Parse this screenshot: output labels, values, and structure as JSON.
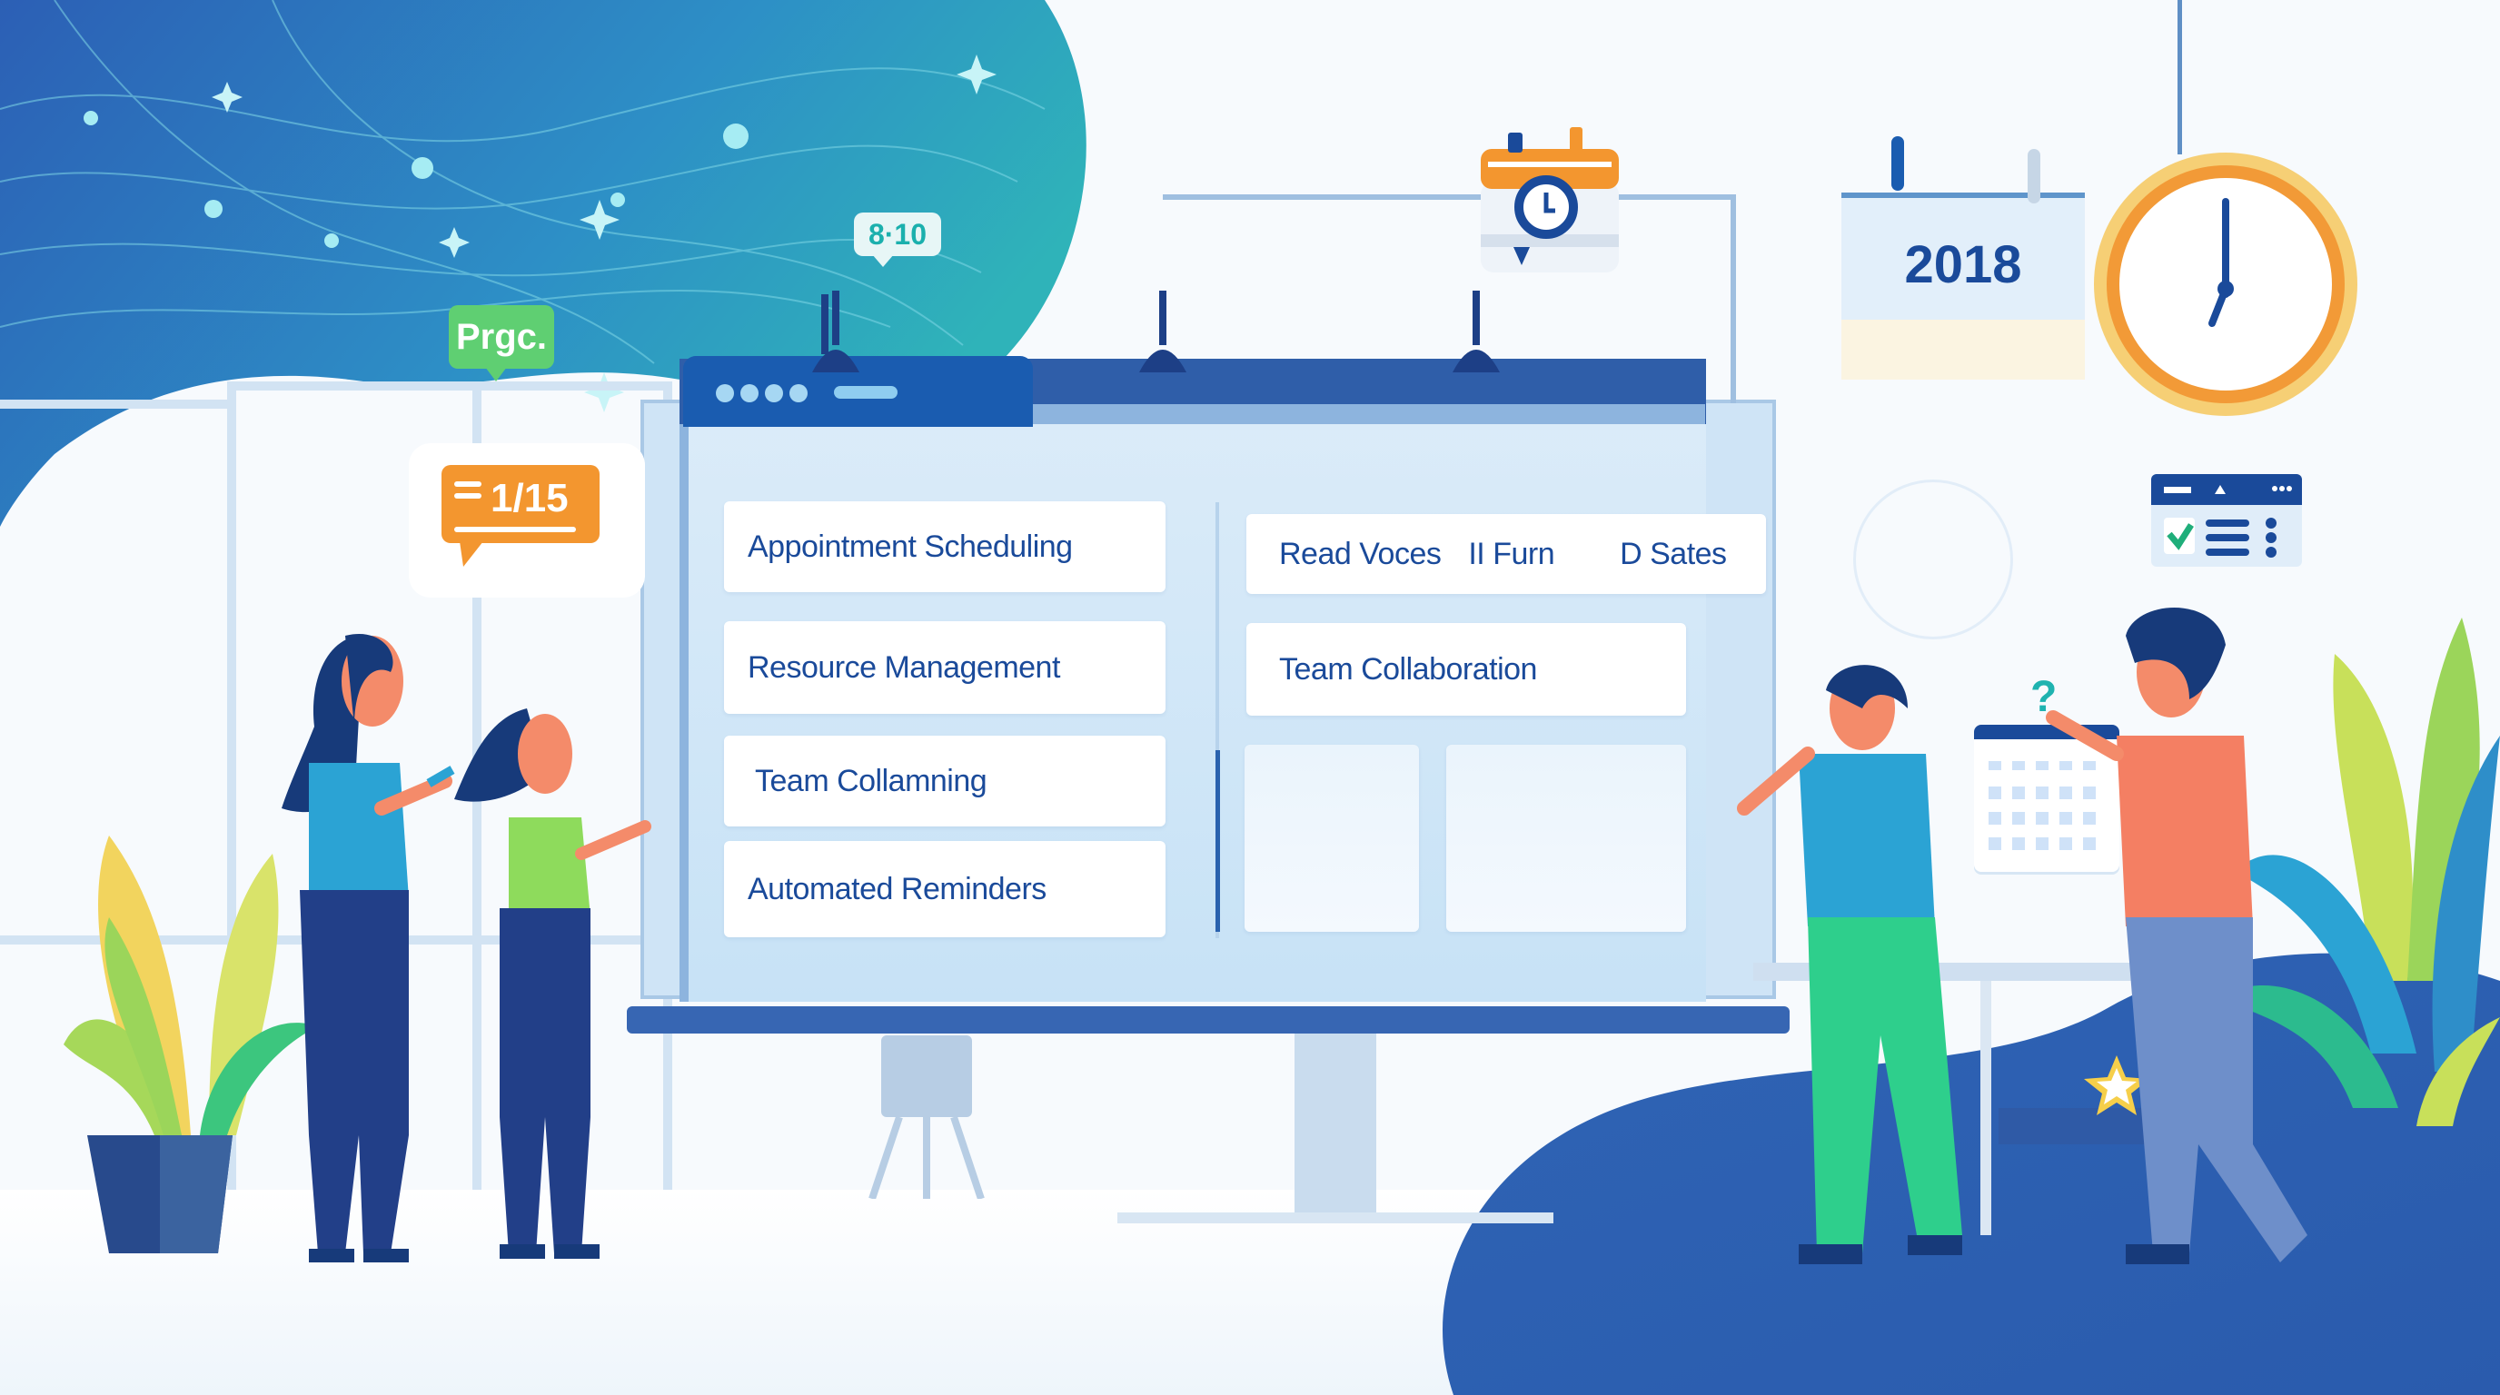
{
  "scene": {
    "description": "Flat illustration of a team using a scheduling app dashboard"
  },
  "panel": {
    "left_column": [
      {
        "label": "Appointment Scheduling"
      },
      {
        "label": "Resource Management"
      },
      {
        "label": "Team Collamning"
      },
      {
        "label": "Automated Reminders"
      }
    ],
    "right_column": {
      "header_items": [
        "Read Voces",
        "II Furn",
        "D Sates"
      ],
      "cards": [
        {
          "label": "Team Collaboration"
        }
      ]
    }
  },
  "badges": {
    "progress_label": "Prgc.",
    "time_label": "8·10",
    "date_label": "1/15",
    "calendar_year": "2018",
    "question_mark": "?"
  },
  "icons": {
    "camera": "camera-clock-icon",
    "clock": "wall-clock-icon",
    "calendar": "calendar-icon",
    "checklist_window": "checklist-window-icon",
    "star": "star-icon"
  },
  "colors": {
    "primary_blue": "#1a4a9a",
    "titlebar_blue": "#2f5ea9",
    "accent_orange": "#f3962f",
    "accent_green": "#5fcf72",
    "accent_teal": "#1bb0ad",
    "clock_gold": "#f6cf75"
  }
}
